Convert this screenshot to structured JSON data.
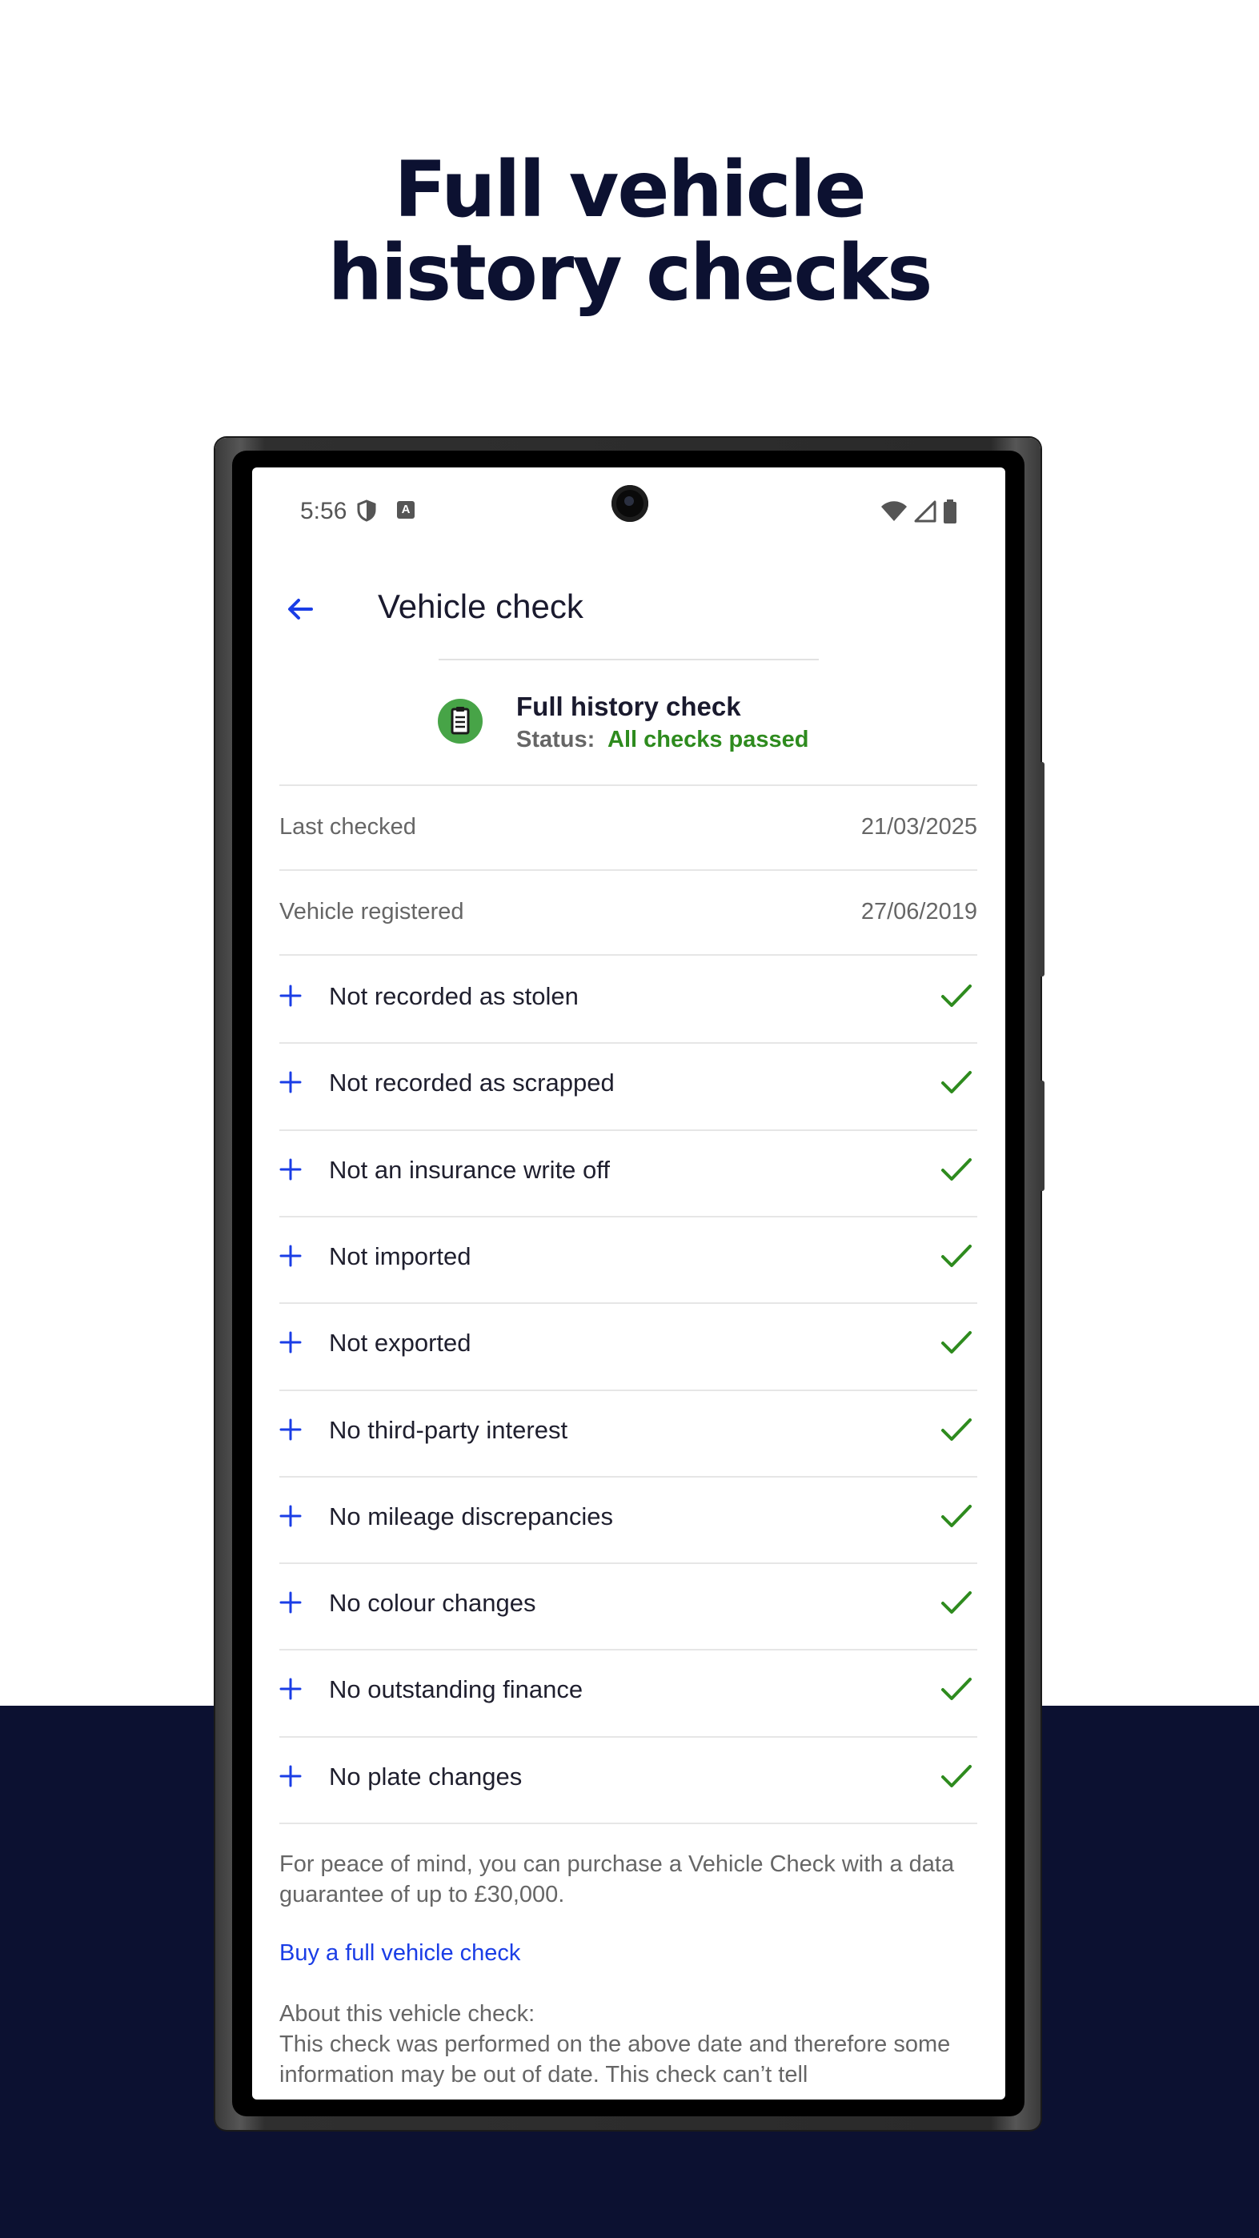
{
  "headline": {
    "line1": "Full vehicle",
    "line2": "history checks"
  },
  "status_bar": {
    "time": "5:56"
  },
  "app_bar": {
    "title": "Vehicle check"
  },
  "summary": {
    "title": "Full history check",
    "status_label": "Status:",
    "status_value": "All checks passed"
  },
  "info_rows": [
    {
      "label": "Last checked",
      "value": "21/03/2025"
    },
    {
      "label": "Vehicle registered",
      "value": "27/06/2019"
    }
  ],
  "checks": [
    {
      "label": "Not recorded as stolen",
      "passed": true
    },
    {
      "label": "Not recorded as scrapped",
      "passed": true
    },
    {
      "label": "Not an insurance write off",
      "passed": true
    },
    {
      "label": "Not imported",
      "passed": true
    },
    {
      "label": "Not exported",
      "passed": true
    },
    {
      "label": "No third-party interest",
      "passed": true
    },
    {
      "label": "No mileage discrepancies",
      "passed": true
    },
    {
      "label": "No colour changes",
      "passed": true
    },
    {
      "label": "No outstanding finance",
      "passed": true
    },
    {
      "label": "No plate changes",
      "passed": true
    }
  ],
  "footer": {
    "peace_of_mind": "For peace of mind, you can purchase a Vehicle Check with a data guarantee of up to £30,000.",
    "buy_link": "Buy a full vehicle check",
    "about_title": "About this vehicle check:",
    "about_body": "This check was performed on the above date and therefore some information may be out of date. This check can’t tell"
  },
  "colors": {
    "navy": "#0c1131",
    "accent_blue": "#1a3de6",
    "pass_green": "#2e8b1e",
    "icon_green": "#47a447"
  }
}
